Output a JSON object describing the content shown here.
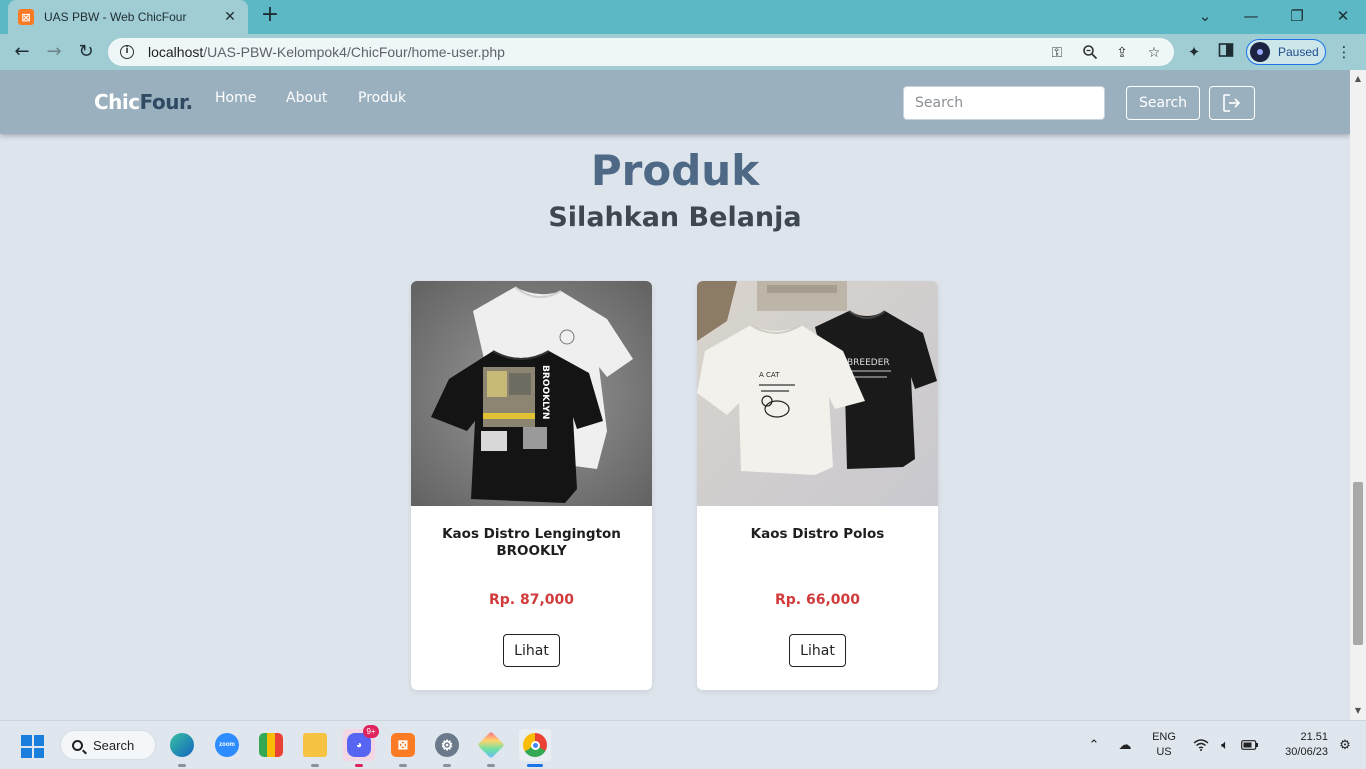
{
  "browser": {
    "tab_title": "UAS PBW - Web ChicFour",
    "tab_close": "✕",
    "new_tab": "+",
    "url_host": "localhost",
    "url_path": "/UAS-PBW-Kelompok4/ChicFour/home-user.php",
    "profile_status": "Paused",
    "window_controls": {
      "menu": "⌄",
      "minimize": "—",
      "restore": "❐",
      "close": "✕"
    }
  },
  "site": {
    "brand_main": "Chic",
    "brand_accent": "Four.",
    "nav": [
      "Home",
      "About",
      "Produk"
    ],
    "search_placeholder": "Search",
    "search_button": "Search",
    "heading": "Produk",
    "subheading": "Silahkan Belanja",
    "products": [
      {
        "name": "Kaos Distro Lengington BROOKLY",
        "price": "Rp. 87,000",
        "button": "Lihat",
        "print_text": "BROOKLYN"
      },
      {
        "name": "Kaos Distro Polos",
        "price": "Rp. 66,000",
        "button": "Lihat",
        "print_text_1": "A CAT",
        "print_text_2": "BREEDER"
      }
    ],
    "colors": {
      "nav_bg": "#9ab0bf",
      "page_bg": "#dde4ec",
      "heading": "#4d6985",
      "price": "#d23b3b"
    }
  },
  "taskbar": {
    "search_label": "Search",
    "zoom_label": "zoom",
    "discord_badge": "9+",
    "language_1": "ENG",
    "language_2": "US",
    "time": "21.51",
    "date": "30/06/23",
    "apps": [
      "windows-start",
      "edge",
      "zoom",
      "google-meet",
      "file-explorer",
      "discord",
      "xampp",
      "settings",
      "git-tool",
      "chrome"
    ]
  }
}
